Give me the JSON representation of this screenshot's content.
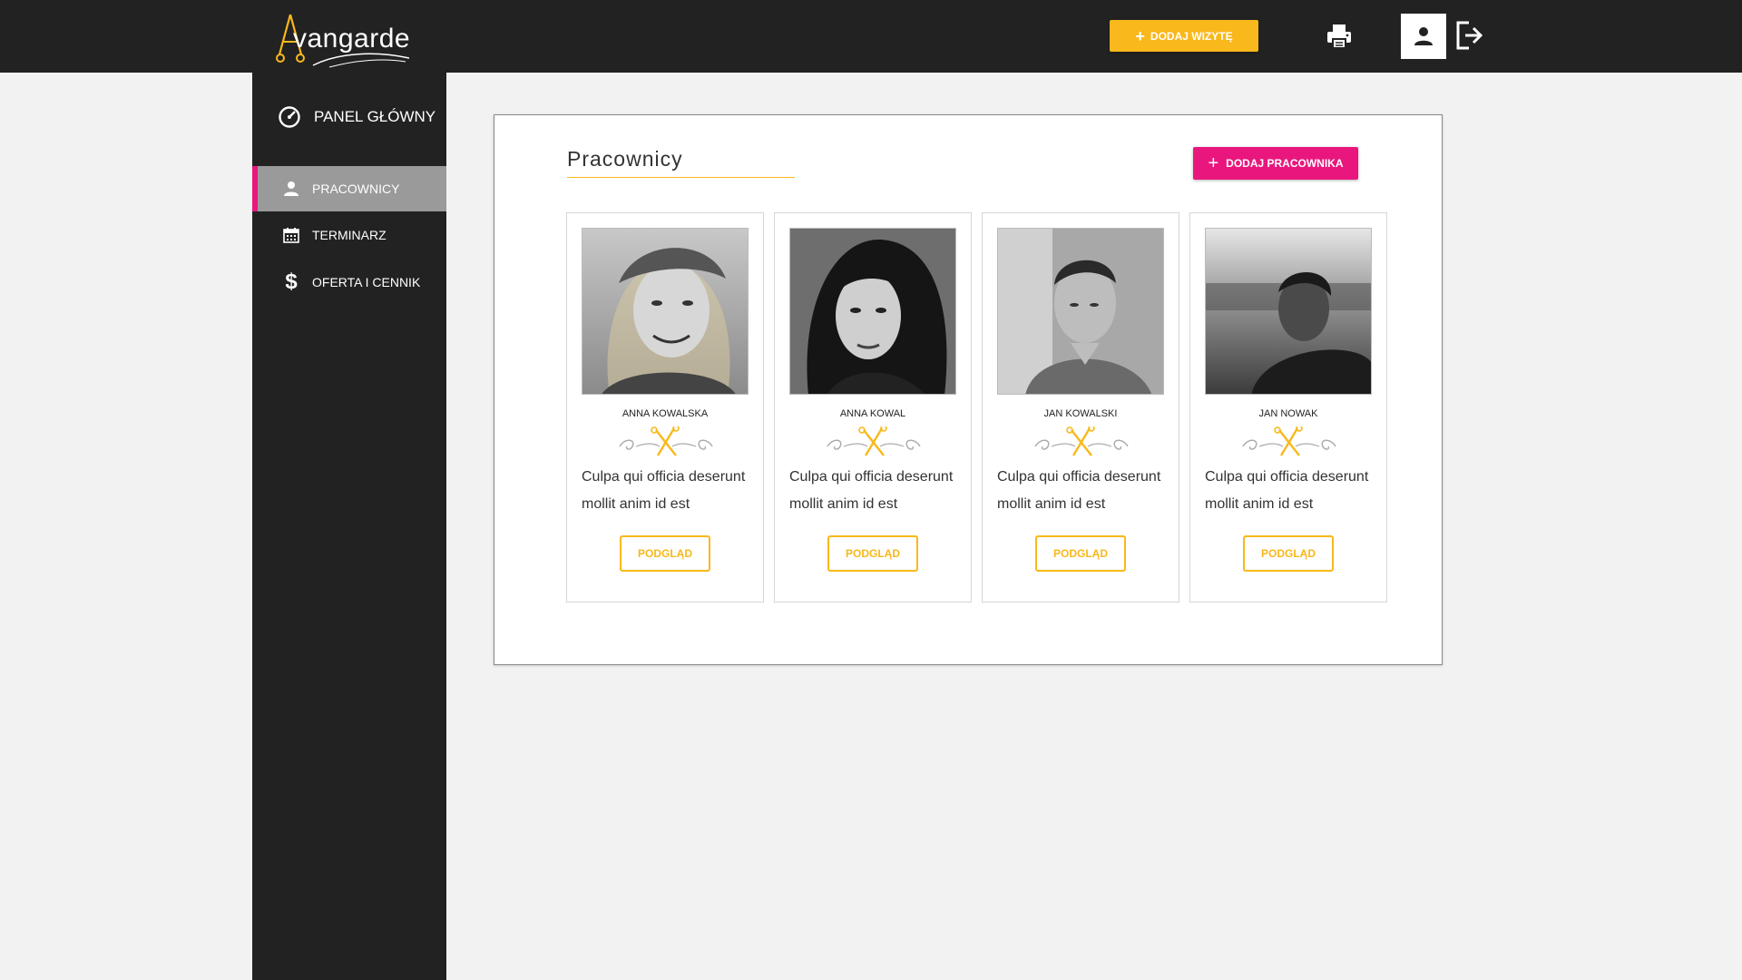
{
  "brand": {
    "logo_text": "vangarde",
    "logo_initial": "A"
  },
  "header": {
    "add_visit_label": "DODAJ WIZYTĘ"
  },
  "sidebar": {
    "panel_label": "PANEL GŁÓWNY",
    "items": [
      {
        "label": "PRACOWNICY",
        "icon": "person-icon",
        "active": true
      },
      {
        "label": "TERMINARZ",
        "icon": "calendar-icon",
        "active": false
      },
      {
        "label": "OFERTA I CENNIK",
        "icon": "dollar-icon",
        "active": false
      }
    ]
  },
  "main": {
    "title": "Pracownicy",
    "add_employee_label": "DODAJ PRACOWNIKA",
    "employees": [
      {
        "name": "ANNA KOWALSKA",
        "description": "Culpa qui officia deserunt mollit anim id est",
        "button": "PODGLĄD"
      },
      {
        "name": "ANNA KOWAL",
        "description": "Culpa qui officia deserunt mollit anim id est",
        "button": "PODGLĄD"
      },
      {
        "name": "JAN KOWALSKI",
        "description": "Culpa qui officia deserunt mollit anim id est",
        "button": "PODGLĄD"
      },
      {
        "name": "JAN NOWAK",
        "description": "Culpa qui officia deserunt mollit anim id est",
        "button": "PODGLĄD"
      }
    ]
  },
  "colors": {
    "accent_yellow": "#f9b81b",
    "accent_pink": "#e9177d",
    "dark": "#222222",
    "active_item_bg": "#9a9a9a"
  }
}
